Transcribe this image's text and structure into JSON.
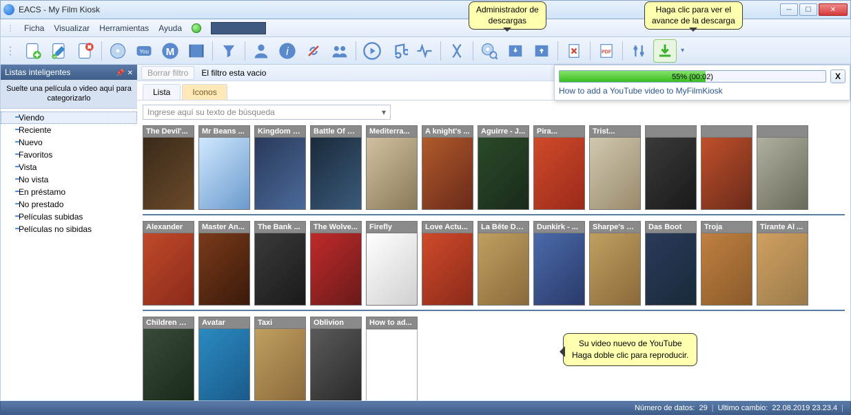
{
  "window": {
    "title": "EACS - My Film Kiosk"
  },
  "menu": {
    "items": [
      "Ficha",
      "Visualizar",
      "Herramientas",
      "Ayuda"
    ]
  },
  "tooltips": {
    "download_mgr": "Administrador de\ndescargas",
    "download_progress": "Haga clic para ver el\navance de la descarga",
    "youtube_new": "Su video nuevo de YouTube\nHaga doble clic para reproducir."
  },
  "toolbar": {
    "icons": [
      "doc-new",
      "doc-edit",
      "doc-delete",
      "disc",
      "youtube",
      "movie-m",
      "film",
      "filter",
      "user",
      "info",
      "break-link",
      "group",
      "play",
      "music",
      "pulse",
      "dna",
      "disc-search",
      "import",
      "export",
      "doc-remove",
      "pdf",
      "settings",
      "download"
    ]
  },
  "sidebar": {
    "title": "Listas inteligentes",
    "drop_hint": "Suelte una película o video aquí para categorizarlo",
    "items": [
      {
        "label": "Viendo",
        "selected": true
      },
      {
        "label": "Reciente"
      },
      {
        "label": "Nuevo"
      },
      {
        "label": "Favoritos"
      },
      {
        "label": "Vista"
      },
      {
        "label": "No vista"
      },
      {
        "label": "En préstamo"
      },
      {
        "label": "No prestado"
      },
      {
        "label": "Películas subidas"
      },
      {
        "label": "Películas no sibidas"
      }
    ]
  },
  "filter": {
    "clear": "Borrar filtro",
    "status": "El filtro esta vacio"
  },
  "tabs": [
    {
      "label": "Lista",
      "active": false
    },
    {
      "label": "Iconos",
      "active": true
    }
  ],
  "search": {
    "placeholder": "Ingrese aquí su texto de búsqueda"
  },
  "download": {
    "percent": 55,
    "time": "00:02",
    "label": "55% (00:02)",
    "title": "How to add a YouTube video to MyFilmKiosk"
  },
  "movies": {
    "row1": [
      {
        "t": "The Devil'...",
        "c": "p1"
      },
      {
        "t": "Mr Beans ...",
        "c": "p2"
      },
      {
        "t": "Kingdom O...",
        "c": "p3"
      },
      {
        "t": "Battle Of B...",
        "c": "p4"
      },
      {
        "t": "Mediterra...",
        "c": "p5"
      },
      {
        "t": "A knight's ...",
        "c": "p6"
      },
      {
        "t": "Aguirre - J...",
        "c": "p7"
      },
      {
        "t": "Pira...",
        "c": "p8"
      },
      {
        "t": "Trist...",
        "c": "p9"
      },
      {
        "t": "",
        "c": "p10"
      },
      {
        "t": "",
        "c": "p11"
      },
      {
        "t": "",
        "c": "p12"
      }
    ],
    "row2": [
      {
        "t": "Alexander",
        "c": "p13"
      },
      {
        "t": "Master An...",
        "c": "p14"
      },
      {
        "t": "The Bank ...",
        "c": "p15"
      },
      {
        "t": "The Wolve...",
        "c": "p16"
      },
      {
        "t": "Firefly",
        "c": "p17"
      },
      {
        "t": "Love Actu...",
        "c": "p18"
      },
      {
        "t": "La Bête Du...",
        "c": "p19"
      },
      {
        "t": "Dunkirk - ...",
        "c": "p20"
      },
      {
        "t": "Sharpe's C...",
        "c": "p21"
      },
      {
        "t": "Das Boot",
        "c": "p22"
      },
      {
        "t": "Troja",
        "c": "p23"
      },
      {
        "t": "Tirante Al ...",
        "c": "p24"
      }
    ],
    "row3": [
      {
        "t": "Children O...",
        "c": "p25"
      },
      {
        "t": "Avatar",
        "c": "p26"
      },
      {
        "t": "Taxi",
        "c": "p27"
      },
      {
        "t": "Oblivion",
        "c": "p28"
      },
      {
        "t": "How to ad...",
        "c": "p29"
      }
    ]
  },
  "status": {
    "count_label": "Número de datos:",
    "count": "29",
    "last_label": "Ultimo cambio:",
    "last": "22.08.2019 23.23.4"
  }
}
